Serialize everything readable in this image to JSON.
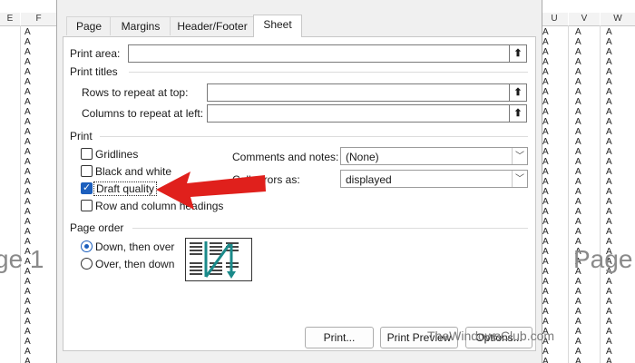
{
  "spreadsheet": {
    "left_columns": [
      "E",
      "F"
    ],
    "right_columns": [
      "U",
      "V",
      "W"
    ],
    "cell_value": "A",
    "watermark_left": "ge 1",
    "watermark_right": "Page"
  },
  "dialog": {
    "tabs": [
      {
        "label": "Page",
        "active": false
      },
      {
        "label": "Margins",
        "active": false
      },
      {
        "label": "Header/Footer",
        "active": false
      },
      {
        "label": "Sheet",
        "active": true
      }
    ],
    "print_area": {
      "label": "Print area:",
      "value": ""
    },
    "print_titles": {
      "heading": "Print titles",
      "rows_label": "Rows to repeat at top:",
      "rows_value": "",
      "cols_label": "Columns to repeat at left:",
      "cols_value": ""
    },
    "print_section": {
      "heading": "Print",
      "gridlines": {
        "label": "Gridlines",
        "checked": false
      },
      "black_white": {
        "label": "Black and white",
        "checked": false
      },
      "draft_quality": {
        "label": "Draft quality",
        "checked": true
      },
      "row_col_headings": {
        "label": "Row and column headings",
        "checked": false
      },
      "comments_label": "Comments and notes:",
      "comments_value": "(None)",
      "errors_label": "Cell errors as:",
      "errors_value": "displayed"
    },
    "page_order": {
      "heading": "Page order",
      "down_over": {
        "label": "Down, then over",
        "selected": true
      },
      "over_down": {
        "label": "Over, then down",
        "selected": false
      }
    },
    "buttons": {
      "print": "Print...",
      "print_preview": "Print Preview",
      "options": "Options..."
    }
  },
  "watermark_brand": "TheWindowsClub.com",
  "colors": {
    "accent": "#1c5fbd",
    "annotation_arrow": "#e0201c"
  }
}
